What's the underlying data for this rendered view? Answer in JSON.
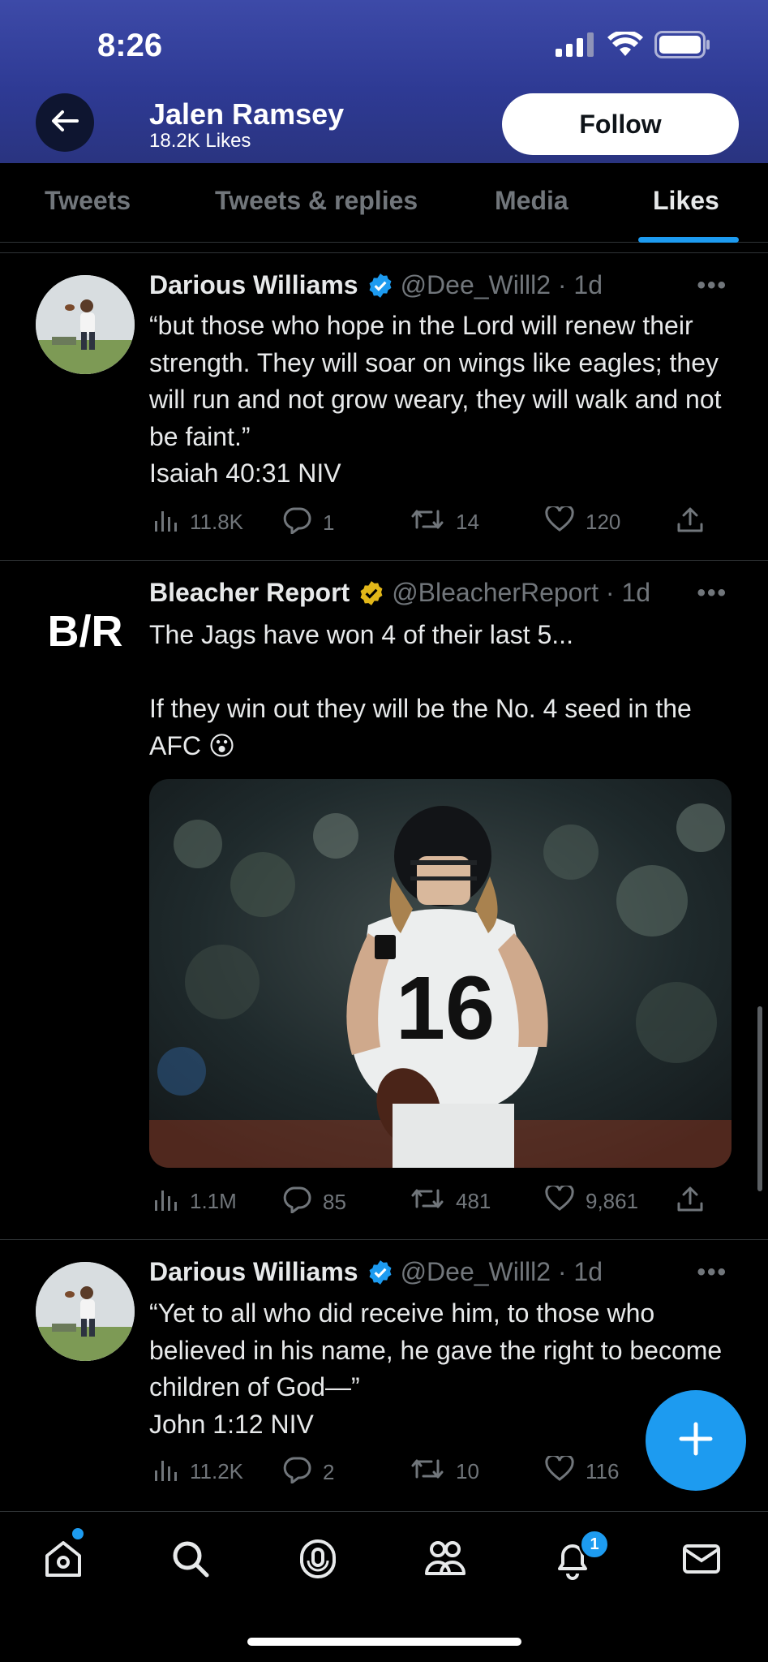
{
  "status_bar": {
    "time": "8:26"
  },
  "profile": {
    "name": "Jalen Ramsey",
    "likes": "18.2K Likes",
    "follow_label": "Follow"
  },
  "tabs": [
    {
      "label": "Tweets"
    },
    {
      "label": "Tweets & replies"
    },
    {
      "label": "Media"
    },
    {
      "label": "Likes"
    }
  ],
  "active_tab": "Likes",
  "tweets": [
    {
      "name": "Darious Williams",
      "badge_color": "#1d9bf0",
      "handle": "@Dee_Willl2 · 1d",
      "text": "“but those who hope in the Lord will renew their strength. They will soar on wings like eagles; they will run and not grow weary, they will walk and not be faint.”\nIsaiah 40:31 NIV",
      "views": "11.8K",
      "replies": "1",
      "retweets": "14",
      "likes": "120"
    },
    {
      "name": "Bleacher Report",
      "badge_color": "#e2b719",
      "handle": "@BleacherReport · 1d",
      "avatar_text": "B/R",
      "text": "The Jags have won 4 of their last 5...\n\nIf they win out they will be the No. 4 seed in the AFC 😮",
      "jersey_number": "16",
      "views": "1.1M",
      "replies": "85",
      "retweets": "481",
      "likes": "9,861"
    },
    {
      "name": "Darious Williams",
      "badge_color": "#1d9bf0",
      "handle": "@Dee_Willl2 · 1d",
      "text": "“Yet to all who did receive him, to those who believed in his name, he gave the right to become children of God—”\nJohn 1:12 NIV",
      "views": "11.2K",
      "replies": "2",
      "retweets": "10",
      "likes": "116"
    }
  ],
  "bottom_nav": {
    "items": [
      "home-icon",
      "search-icon",
      "spaces-icon",
      "communities-icon",
      "notifications-icon",
      "messages-icon"
    ],
    "notification_count": "1"
  },
  "accent_color": "#1d9bf0"
}
